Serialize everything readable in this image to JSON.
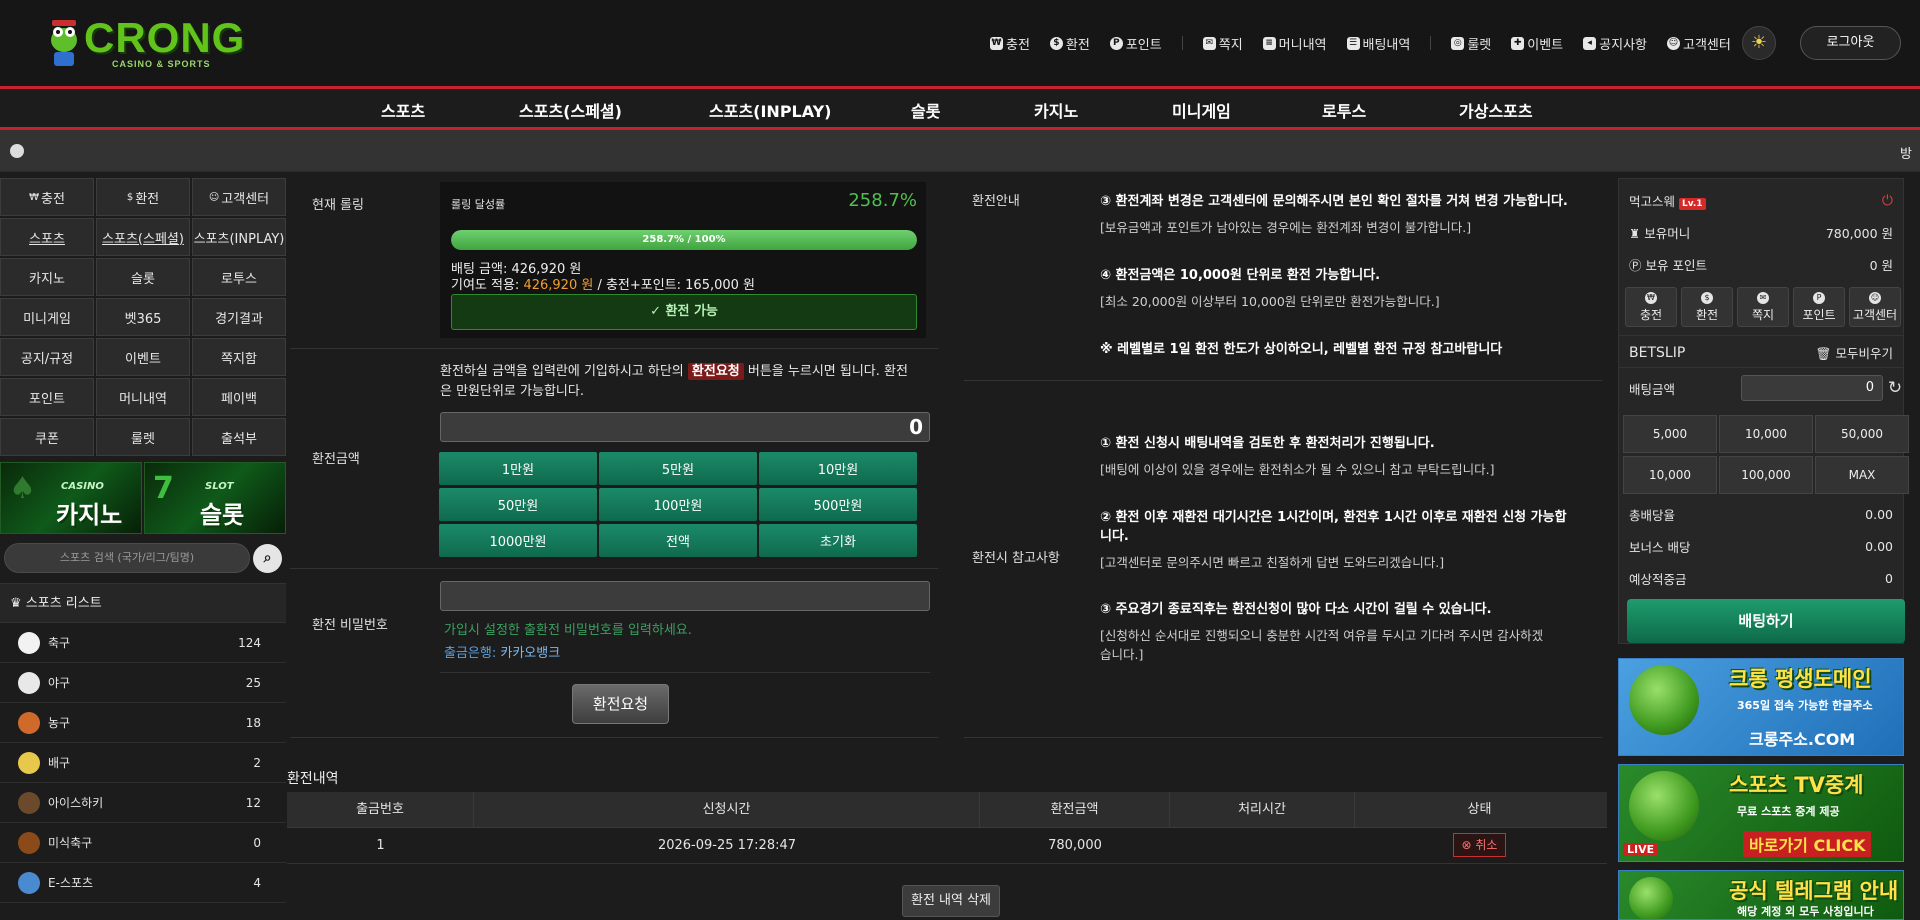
{
  "brand": {
    "name": "CRONG",
    "sub": "CASINO & SPORTS"
  },
  "topnav": [
    {
      "icon": "charge-icon",
      "label": "충전"
    },
    {
      "icon": "exchange-icon",
      "label": "환전"
    },
    {
      "icon": "point-icon",
      "label": "포인트"
    },
    {
      "icon": "mail-icon",
      "label": "쪽지"
    },
    {
      "icon": "money-history-icon",
      "label": "머니내역"
    },
    {
      "icon": "bet-history-icon",
      "label": "배팅내역"
    },
    {
      "icon": "roulette-icon",
      "label": "룰렛"
    },
    {
      "icon": "gift-icon",
      "label": "이벤트"
    },
    {
      "icon": "megaphone-icon",
      "label": "공지사항"
    },
    {
      "icon": "support-icon",
      "label": "고객센터"
    }
  ],
  "logout": "로그아웃",
  "mainnav": [
    "스포츠",
    "스포츠(스페셜)",
    "스포츠(INPLAY)",
    "슬롯",
    "카지노",
    "미니게임",
    "로투스",
    "가상스포츠"
  ],
  "ticker": "방",
  "leftgrid": [
    "충전",
    "환전",
    "고객센터",
    "스포츠",
    "스포츠(스페셜)",
    "스포츠(INPLAY)",
    "카지노",
    "슬롯",
    "로투스",
    "미니게임",
    "벳365",
    "경기결과",
    "공지/규정",
    "이벤트",
    "쪽지함",
    "포인트",
    "머니내역",
    "페이백",
    "쿠폰",
    "룰렛",
    "출석부"
  ],
  "banners": {
    "casino": {
      "small": "CASINO",
      "big": "카지노"
    },
    "slot": {
      "small": "SLOT",
      "big": "슬롯"
    }
  },
  "search_placeholder": "스포츠 검색 (국가/리그/팀명)",
  "sports_list_title": "스포츠 리스트",
  "sports": [
    {
      "name": "축구",
      "count": "124",
      "color": "#f2f2f2"
    },
    {
      "name": "야구",
      "count": "25",
      "color": "#e8e8e8"
    },
    {
      "name": "농구",
      "count": "18",
      "color": "#d06a2a"
    },
    {
      "name": "배구",
      "count": "2",
      "color": "#e8c84a"
    },
    {
      "name": "아이스하키",
      "count": "12",
      "color": "#6a4a2a"
    },
    {
      "name": "미식축구",
      "count": "0",
      "color": "#8a4a1a"
    },
    {
      "name": "E-스포츠",
      "count": "4",
      "color": "#4a8ad0"
    }
  ],
  "rolling": {
    "label": "현재 롤링",
    "title": "롤링 달성률",
    "percent": "258.7%",
    "progress_fraction": 1.0,
    "progress_text": "258.7% / 100%",
    "bet_amount": "배팅 금액: 426,920 원",
    "contrib_label": "기여도 적용: ",
    "contrib_value": "426,920 원",
    "contrib_tail": " / 충전+포인트: 165,000 원",
    "status": "✓ 환전 가능"
  },
  "amount": {
    "label": "환전금액",
    "desc1": "환전하실 금액을 입력란에 기입하시고 하단의 ",
    "desc_badge": "환전요청",
    "desc2": " 버튼을 누르시면 됩니다. 환전",
    "desc3": "은 만원단위로 가능합니다.",
    "value": "0",
    "buttons": [
      "1만원",
      "5만원",
      "10만원",
      "50만원",
      "100만원",
      "500만원",
      "1000만원",
      "전액",
      "초기화"
    ]
  },
  "password": {
    "label": "환전 비밀번호",
    "hint": "가입시 설정한 출환전 비밀번호를 입력하세요.",
    "bank_label": "출금은행: ",
    "bank_value": "카카오뱅크"
  },
  "request_btn": "환전요청",
  "guide": {
    "label": "환전안내",
    "items": [
      {
        "title": "③ 환전계좌 변경은 고객센터에 문의해주시면 본인 확인 절차를 거쳐 변경 가능합니다.",
        "sub": "[보유금액과 포인트가 남아있는 경우에는 환전계좌 변경이 불가합니다.]"
      },
      {
        "title": "④ 환전금액은 10,000원 단위로 환전 가능합니다.",
        "sub": "[최소 20,000원 이상부터 10,000원 단위로만 환전가능합니다.]"
      },
      {
        "title": "※ 레벨별로 1일 환전 한도가 상이하오니, 레벨별 환전 규정 참고바랍니다",
        "sub": ""
      }
    ]
  },
  "reference": {
    "label": "환전시 참고사항",
    "items": [
      {
        "title": "① 환전 신청시 배팅내역을 검토한 후 환전처리가 진행됩니다.",
        "sub": "[배팅에 이상이 있을 경우에는 환전취소가 될 수 있으니 참고 부탁드립니다.]"
      },
      {
        "title": "② 환전 이후 재환전 대기시간은 1시간이며, 환전후 1시간 이후로 재환전 신청 가능합",
        "title2": "니다.",
        "sub": "[고객센터로 문의주시면 빠르고 친절하게 답변 도와드리겠습니다.]"
      },
      {
        "title": "③ 주요경기 종료직후는 환전신청이 많아 다소 시간이 걸릴 수 있습니다.",
        "sub": "[신청하신 순서대로 진행되오니 충분한 시간적 여유를 두시고 기다려 주시면 감사하겠",
        "sub2": "습니다.]"
      }
    ]
  },
  "history": {
    "title": "환전내역",
    "columns": [
      "출금번호",
      "신청시간",
      "환전금액",
      "처리시간",
      "상태"
    ],
    "rows": [
      {
        "no": "1",
        "time": "2026-09-25 17:28:47",
        "amount": "780,000",
        "processed": "",
        "status": "취소"
      }
    ],
    "delete_btn": "환전 내역 삭제"
  },
  "right": {
    "user": "먹고스웨",
    "level": "Lv.1",
    "money_label": "보유머니",
    "money": "780,000 원",
    "point_label": "보유 포인트",
    "point": "0 원",
    "quick": [
      "충전",
      "환전",
      "쪽지",
      "포인트",
      "고객센터"
    ],
    "betslip": "BETSLIP",
    "clear_all": "모두비우기",
    "bet_amount_label": "배팅금액",
    "bet_amount": "0",
    "bet_buttons": [
      "5,000",
      "10,000",
      "50,000",
      "10,000",
      "100,000",
      "MAX"
    ],
    "total_odds_label": "총배당율",
    "total_odds": "0.00",
    "bonus_label": "보너스 배당",
    "bonus": "0.00",
    "expected_label": "예상적중금",
    "expected": "0",
    "bet_btn": "배팅하기"
  },
  "right_banners": [
    {
      "t1": "크롱 평생도메인",
      "t2": "365일 접속 가능한 한글주소",
      "t3": "크롱주소.COM"
    },
    {
      "t1": "스포츠 TV중계",
      "t2": "무료 스포츠 중계 제공",
      "t3": "바로가기 CLICK"
    },
    {
      "t1": "공식 텔레그램 안내",
      "t2": "해당 계정 외 모두 사칭입니다",
      "t3": ""
    }
  ]
}
